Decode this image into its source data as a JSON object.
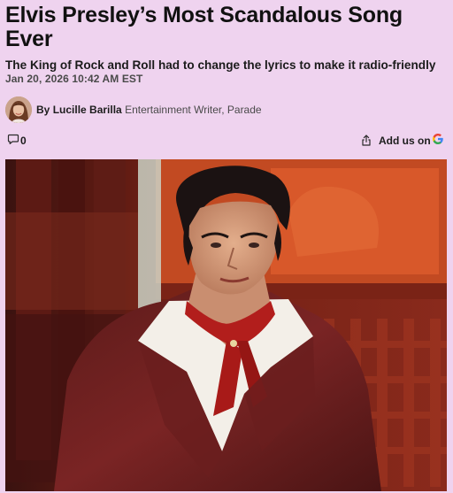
{
  "article": {
    "title": "Elvis Presley’s Most Scandalous Song Ever",
    "subtitle": "The King of Rock and Roll had to change the lyrics to make it radio-friendly",
    "dateline": "Jan 20, 2026 10:42 AM EST",
    "byline": {
      "prefix": "By",
      "author": "Lucille Barilla",
      "role": "Entertainment Writer, Parade"
    },
    "comments_count": "0",
    "add_us_label": "Add us on"
  },
  "icons": {
    "comment": "comment-icon",
    "share": "share-icon",
    "google": "google-g-icon",
    "avatar": "author-avatar"
  },
  "colors": {
    "page_background": "#efd3ef",
    "text": "#111111",
    "muted": "#4a4a4a",
    "google_blue": "#4285F4",
    "google_red": "#EA4335",
    "google_yellow": "#FBBC05",
    "google_green": "#34A853"
  }
}
